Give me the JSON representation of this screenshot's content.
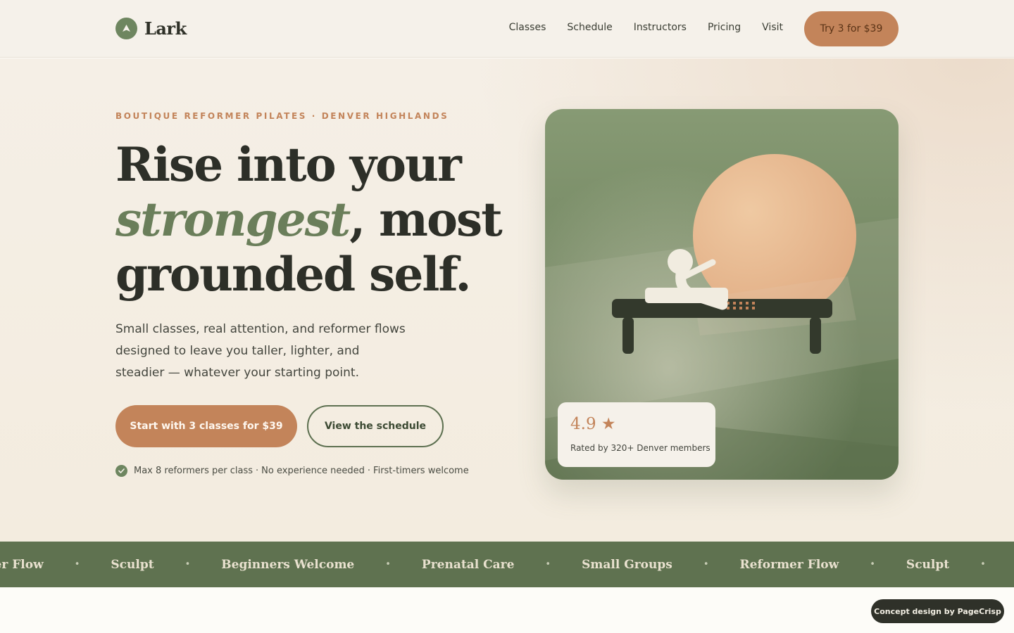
{
  "brand": {
    "name": "Lark",
    "icon": "bird-icon"
  },
  "nav": {
    "links": [
      "Classes",
      "Schedule",
      "Instructors",
      "Pricing",
      "Visit"
    ],
    "cta": "Try 3 for $39"
  },
  "hero": {
    "eyebrow": "BOUTIQUE REFORMER PILATES · DENVER HIGHLANDS",
    "headline": {
      "line1": "Rise into your",
      "accent": "strongest",
      "line2_rest": ", most",
      "line3": "grounded self."
    },
    "subcopy": "Small classes, real attention, and reformer flows designed to leave you taller, lighter, and steadier — whatever your starting point.",
    "primary_button": "Start with 3 classes for $39",
    "secondary_button": "View the schedule",
    "features": [
      "Max 8 reformers per class",
      "No experience needed",
      "First-timers welcome"
    ],
    "feature_separator": "·"
  },
  "rating": {
    "value": "4.9 ★",
    "caption": "Rated by 320+ Denver members"
  },
  "marquee": {
    "items": [
      "Reformer Flow",
      "Sculpt",
      "Beginners Welcome",
      "Prenatal Care",
      "Small Groups",
      "Reformer Flow",
      "Sculpt"
    ],
    "separator": "•"
  },
  "badge": {
    "label": "Concept design by PageCrisp"
  },
  "colors": {
    "accent": "#c3845a",
    "sage": "#6e8660",
    "dark": "#2d2f28",
    "cream": "#f5f1ea"
  }
}
